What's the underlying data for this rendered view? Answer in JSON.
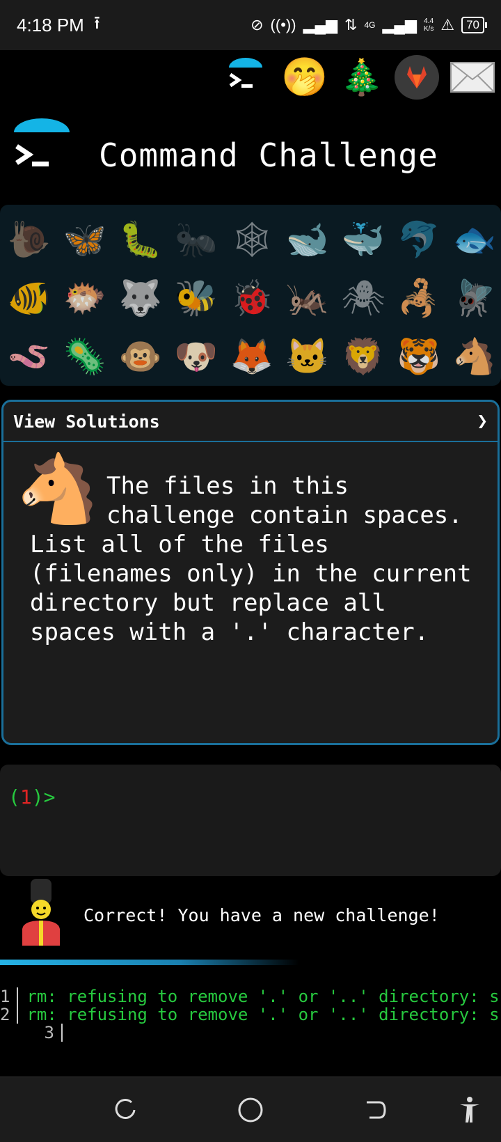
{
  "status": {
    "time": "4:18 PM",
    "network": "4G",
    "speed_value": "4.4",
    "speed_unit": "K/s",
    "battery": "70"
  },
  "app": {
    "title": "Command Challenge"
  },
  "solutions": {
    "label": "View Solutions",
    "arrow": "❯"
  },
  "challenge": {
    "text": "The files in this challenge contain spaces. List all of the files (filenames only) in the current directory but replace all spaces with a '.' character."
  },
  "terminal": {
    "prompt_open": "(",
    "prompt_number": "1",
    "prompt_close": ")>"
  },
  "feedback": {
    "text": "Correct! You have a new challenge!"
  },
  "output": {
    "lines": [
      {
        "num": "1",
        "text": "rm: refusing to remove '.' or '..' directory: skipping '.'"
      },
      {
        "num": "2",
        "text": "rm: refusing to remove '.' or '..' directory: skipping '..'"
      },
      {
        "num": "3",
        "text": ""
      }
    ]
  },
  "animals": [
    "snail-icon",
    "butterfly-icon",
    "caterpillar-icon",
    "ant-icon",
    "spider-web-icon",
    "whale-icon",
    "whale2-icon",
    "dolphin-icon",
    "fish-icon",
    "tropical-fish-icon",
    "blowfish-icon",
    "wolf-icon",
    "bee-icon",
    "ladybug-icon",
    "cricket-icon",
    "spider-icon",
    "scorpion-icon",
    "fly-icon",
    "worm-icon",
    "microbe-icon",
    "monkey-icon",
    "dog-icon",
    "fox-icon",
    "cat-icon",
    "lion-icon",
    "tiger-icon",
    "horse-icon"
  ]
}
